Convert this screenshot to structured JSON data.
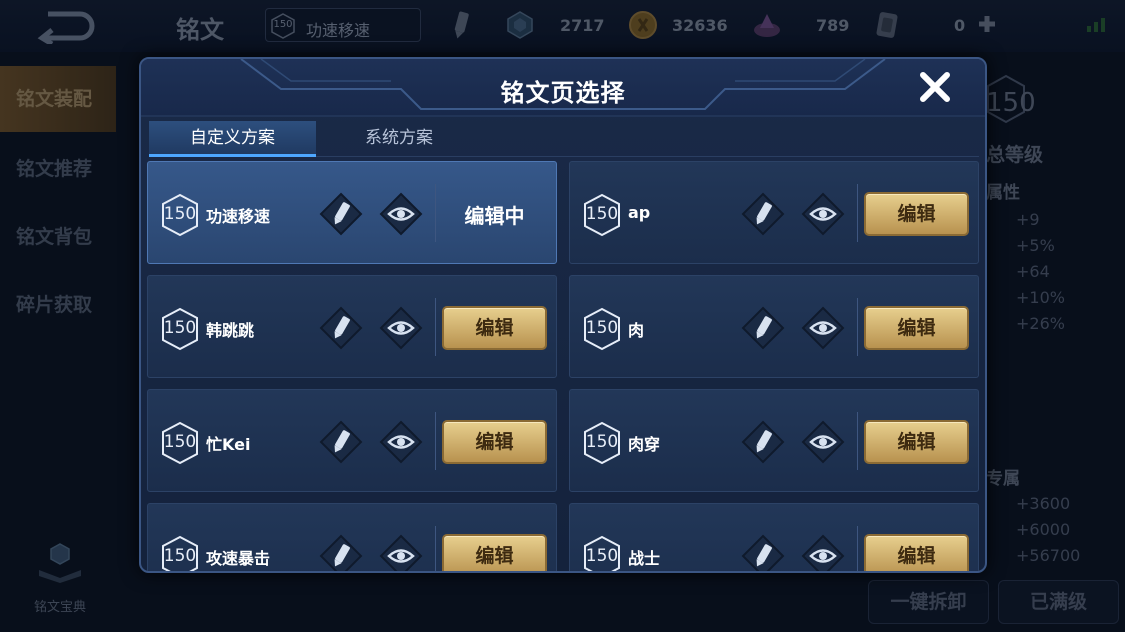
{
  "header": {
    "page_title": "铭文",
    "current_page_level": "150",
    "current_page_name": "功速移速",
    "resources": [
      {
        "icon": "hex-gem-icon",
        "value": "2717"
      },
      {
        "icon": "gold-coin-icon",
        "value": "32636"
      },
      {
        "icon": "purple-crystal-icon",
        "value": "789"
      },
      {
        "icon": "card-icon",
        "value": "0"
      }
    ]
  },
  "sidebar": {
    "items": [
      {
        "label": "铭文装配",
        "active": true
      },
      {
        "label": "铭文推荐",
        "active": false
      },
      {
        "label": "铭文背包",
        "active": false
      },
      {
        "label": "碎片获取",
        "active": false
      }
    ],
    "codex_label": "铭文宝典"
  },
  "right_panel": {
    "level": "150",
    "total_level_label": "总等级",
    "attr_label": "属性",
    "attr_values": [
      "+9",
      "+5%",
      "+64",
      "+10%",
      "+26%"
    ],
    "exclusive_label": "专属",
    "exclusive_values": [
      "+3600",
      "+6000",
      "+56700"
    ],
    "unload_label": "一键拆卸",
    "maxed_label": "已满级"
  },
  "modal": {
    "title": "铭文页选择",
    "tabs": [
      {
        "label": "自定义方案",
        "active": true
      },
      {
        "label": "系统方案",
        "active": false
      }
    ],
    "edit_label": "编辑",
    "editing_label": "编辑中",
    "pages": [
      {
        "level": "150",
        "name": "功速移速",
        "editing": true
      },
      {
        "level": "150",
        "name": "ap",
        "editing": false
      },
      {
        "level": "150",
        "name": "韩跳跳",
        "editing": false
      },
      {
        "level": "150",
        "name": "肉",
        "editing": false
      },
      {
        "level": "150",
        "name": "忙Kei",
        "editing": false
      },
      {
        "level": "150",
        "name": "肉穿",
        "editing": false
      },
      {
        "level": "150",
        "name": "攻速暴击",
        "editing": false
      },
      {
        "level": "150",
        "name": "战士",
        "editing": false
      }
    ]
  },
  "colors": {
    "gold_button": "#d2b271",
    "selected_card": "#36588a",
    "tab_underline": "#4ea7ff"
  }
}
